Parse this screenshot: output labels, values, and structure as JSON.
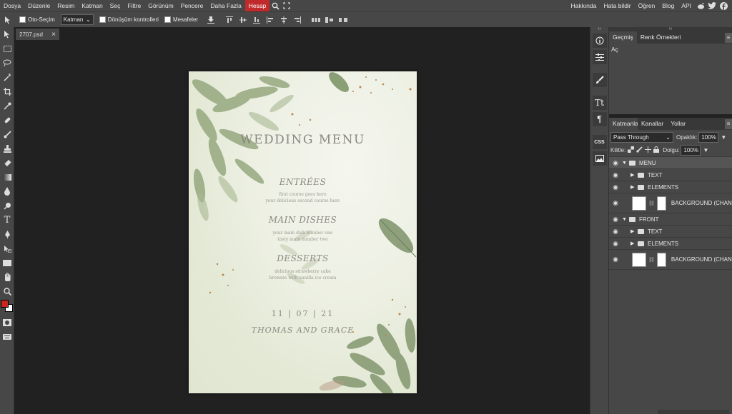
{
  "menubar": {
    "items": [
      "Dosya",
      "Düzenle",
      "Resim",
      "Katman",
      "Seç",
      "Filtre",
      "Görünüm",
      "Pencere",
      "Daha Fazla",
      "Hesap"
    ],
    "right_links": [
      "Hakkında",
      "Hata bildir",
      "Öğren",
      "Blog",
      "API"
    ],
    "icons": [
      "search-icon",
      "fullscreen-icon",
      "reddit-icon",
      "twitter-icon",
      "facebook-icon"
    ]
  },
  "options": {
    "auto_select_label": "Oto-Seçim",
    "auto_select_value": "Katman",
    "transform_label": "Dönüşüm kontrolleri",
    "distances_label": "Mesafeler"
  },
  "document": {
    "tab_name": "2707.psd",
    "close": "×"
  },
  "canvas": {
    "title": "WEDDING MENU",
    "sections": [
      {
        "heading": "ENTRÉES",
        "lines": [
          "first course goes here",
          "your delicious second course here"
        ]
      },
      {
        "heading": "MAIN DISHES",
        "lines": [
          "your main dish number one",
          "tasty main number two"
        ]
      },
      {
        "heading": "DESSERTS",
        "lines": [
          "delicious strawberry cake",
          "brownie with vanilla ice cream"
        ]
      }
    ],
    "date": "11 | 07 | 21",
    "names": "THOMAS AND GRACE"
  },
  "history_panel": {
    "tabs": [
      "Geçmiş",
      "Renk Örnekleri"
    ],
    "items": [
      "Aç"
    ]
  },
  "layers_panel": {
    "tabs": [
      "Katmanlar",
      "Kanallar",
      "Yollar"
    ],
    "blend_mode": "Pass Through",
    "opacity_label": "Opaklık:",
    "opacity_value": "100%",
    "lock_label": "Kilitle:",
    "fill_label": "Dolgu:",
    "fill_value": "100%",
    "layers": [
      {
        "name": "MENU",
        "type": "group",
        "depth": 0
      },
      {
        "name": "TEXT",
        "type": "group",
        "depth": 1
      },
      {
        "name": "ELEMENTS",
        "type": "group",
        "depth": 1
      },
      {
        "name": "BACKGROUND (CHAN",
        "type": "smart",
        "depth": 1
      },
      {
        "name": "FRONT",
        "type": "group",
        "depth": 0
      },
      {
        "name": "TEXT",
        "type": "group",
        "depth": 1
      },
      {
        "name": "ELEMENTS",
        "type": "group",
        "depth": 1
      },
      {
        "name": "BACKGROUND (CHAN",
        "type": "smart",
        "depth": 1
      }
    ]
  },
  "colors": {
    "foreground": "#c7261c",
    "background": "#ffffff",
    "accent": "#c12a2a"
  }
}
